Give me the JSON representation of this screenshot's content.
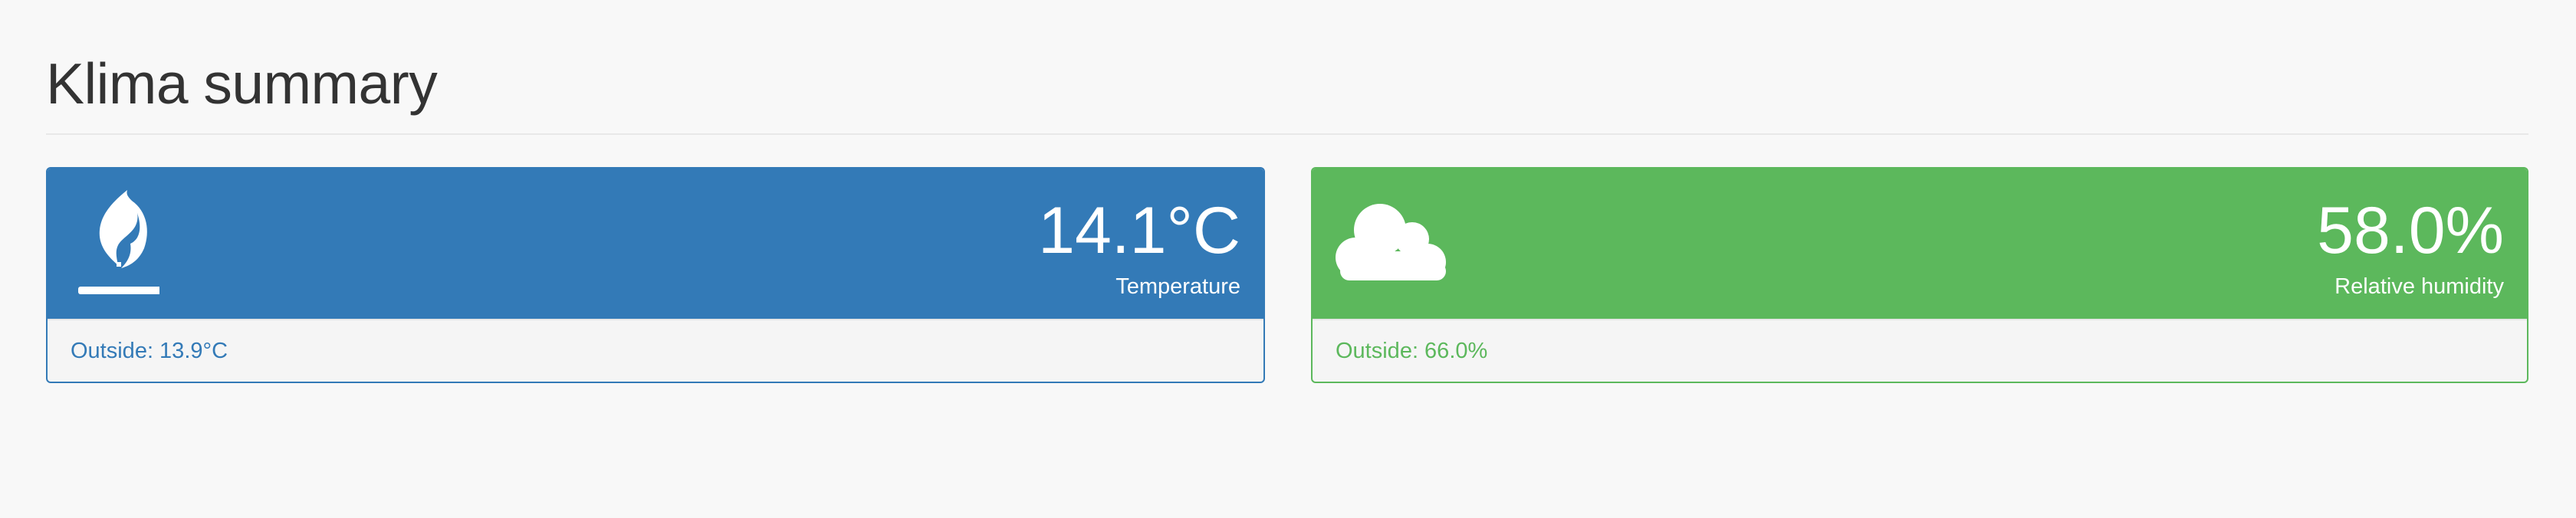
{
  "page": {
    "title": "Klima summary"
  },
  "panels": {
    "temperature": {
      "value": "14.1°C",
      "label": "Temperature",
      "footer": "Outside: 13.9°C",
      "icon": "flame-icon",
      "color": "#337ab7"
    },
    "humidity": {
      "value": "58.0%",
      "label": "Relative humidity",
      "footer": "Outside: 66.0%",
      "icon": "cloud-icon",
      "color": "#5cb85c"
    }
  }
}
